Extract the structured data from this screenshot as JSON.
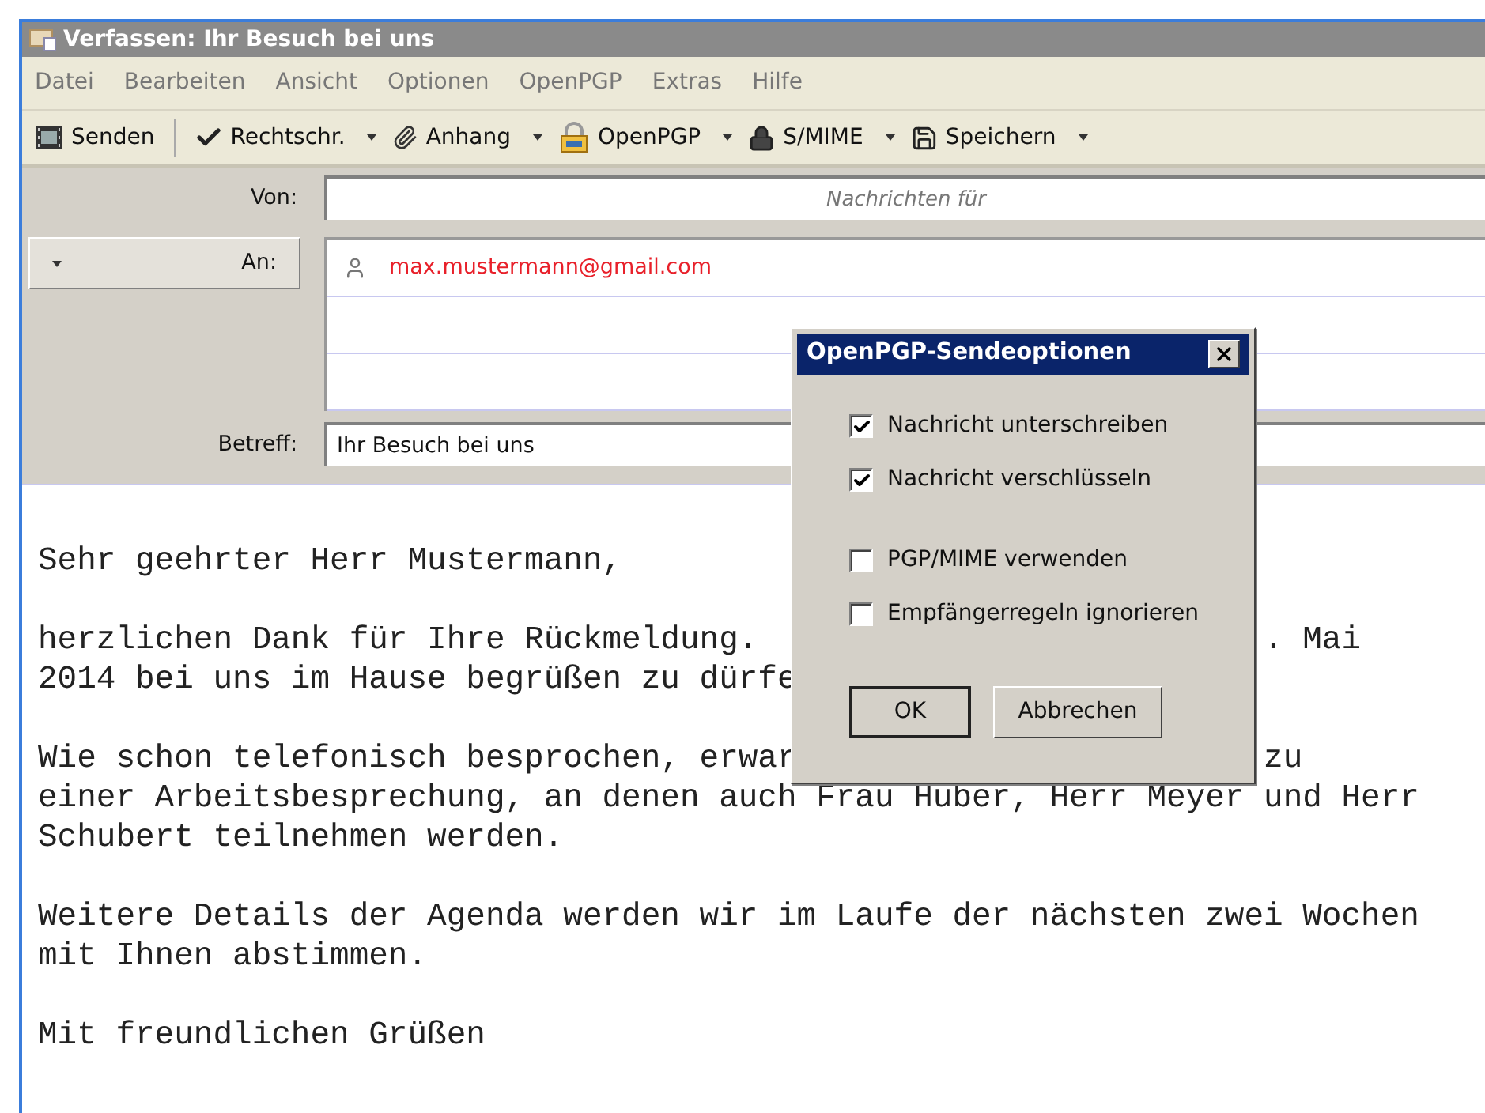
{
  "window": {
    "title": "Verfassen: Ihr Besuch bei uns"
  },
  "menu": [
    "Datei",
    "Bearbeiten",
    "Ansicht",
    "Optionen",
    "OpenPGP",
    "Extras",
    "Hilfe"
  ],
  "toolbar": [
    {
      "label": "Senden",
      "kind": "send",
      "dropdown": false
    },
    {
      "label": "Rechtschr.",
      "kind": "spell",
      "dropdown": true
    },
    {
      "label": "Anhang",
      "kind": "attach",
      "dropdown": true
    },
    {
      "label": "OpenPGP",
      "kind": "pgp",
      "dropdown": true
    },
    {
      "label": "S/MIME",
      "kind": "lock",
      "dropdown": true
    },
    {
      "label": "Speichern",
      "kind": "save",
      "dropdown": true
    }
  ],
  "from": {
    "label": "Von:",
    "placeholder": "Nachrichten für"
  },
  "to": {
    "label": "An:",
    "recipients": [
      "max.mustermann@gmail.com"
    ]
  },
  "subject": {
    "label": "Betreff:",
    "value": "Ihr Besuch bei uns"
  },
  "body": [
    [
      {
        "left": "Sehr geehrter Herr Mustermann,"
      }
    ],
    [
      {
        "left": "herzlichen Dank für Ihre Rückmeldung.",
        "right": ". Mai"
      },
      {
        "left": "2014 bei uns im Hause begrüßen zu dürfe"
      }
    ],
    [
      {
        "left": "Wie schon telefonisch besprochen, erwar",
        "right": "zu"
      },
      {
        "left": "einer Arbeitsbesprechung, an denen auch Frau Huber, Herr Meyer und Herr"
      },
      {
        "left": "Schubert teilnehmen werden."
      }
    ],
    [
      {
        "left": "Weitere Details der Agenda werden wir im Laufe der nächsten zwei Wochen"
      },
      {
        "left": "mit Ihnen abstimmen."
      }
    ],
    [
      {
        "left": "Mit freundlichen Grüßen"
      }
    ]
  ],
  "dialog": {
    "title": "OpenPGP-Sendeoptionen",
    "option_groups": [
      [
        {
          "label": "Nachricht unterschreiben",
          "checked": true
        },
        {
          "label": "Nachricht verschlüsseln",
          "checked": true
        }
      ],
      [
        {
          "label": "PGP/MIME verwenden",
          "checked": false
        },
        {
          "label": "Empfängerregeln ignorieren",
          "checked": false
        }
      ]
    ],
    "buttons": [
      {
        "label": "OK",
        "default": true
      },
      {
        "label": "Abbrechen",
        "default": false
      }
    ]
  }
}
